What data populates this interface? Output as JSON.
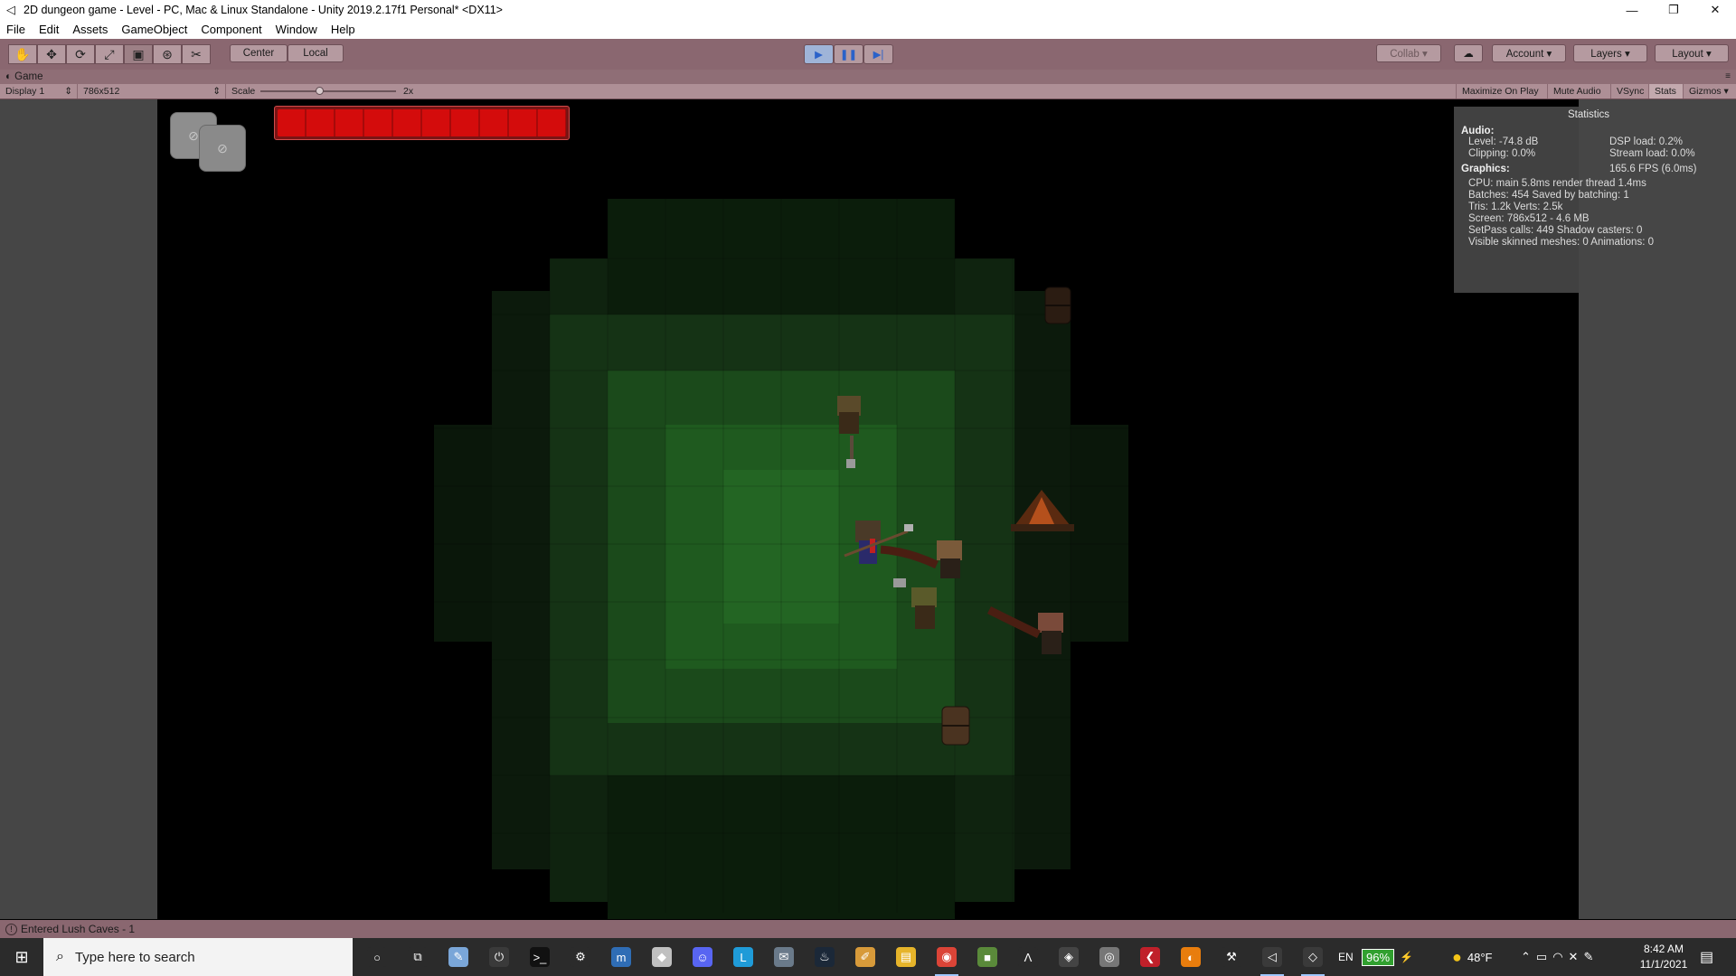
{
  "window": {
    "title": "2D dungeon game - Level - PC, Mac & Linux Standalone - Unity 2019.2.17f1 Personal* <DX11>",
    "app_icon": "unity-logo-icon",
    "controls": {
      "minimize": "—",
      "restore": "❐",
      "close": "✕"
    }
  },
  "menu": [
    "File",
    "Edit",
    "Assets",
    "GameObject",
    "Component",
    "Window",
    "Help"
  ],
  "toolbar": {
    "tools": [
      {
        "name": "hand-tool",
        "glyph": "✋"
      },
      {
        "name": "move-tool",
        "glyph": "✥"
      },
      {
        "name": "rotate-tool",
        "glyph": "⟳"
      },
      {
        "name": "scale-tool",
        "glyph": "⤢"
      },
      {
        "name": "rect-tool",
        "glyph": "▣"
      },
      {
        "name": "transform-tool",
        "glyph": "⊛"
      },
      {
        "name": "custom-tool",
        "glyph": "✂"
      }
    ],
    "pivot": "Center",
    "space": "Local",
    "play": "▶",
    "pause": "❚❚",
    "step": "▶|",
    "collab": "Collab ▾",
    "cloud": "☁",
    "account": "Account ▾",
    "layers": "Layers ▾",
    "layout": "Layout ▾"
  },
  "game_view": {
    "tab": "Game",
    "display": "Display 1",
    "resolution": "786x512",
    "scale_label": "Scale",
    "scale_value": "2x",
    "buttons": [
      "Maximize On Play",
      "Mute Audio",
      "VSync",
      "Stats",
      "Gizmos ▾"
    ]
  },
  "hud": {
    "slot_icon": "⊘",
    "health_fraction": 1.0
  },
  "stats": {
    "title": "Statistics",
    "audio_header": "Audio:",
    "audio": [
      [
        "Level: -74.8 dB",
        "DSP load: 0.2%"
      ],
      [
        "Clipping: 0.0%",
        "Stream load: 0.0%"
      ]
    ],
    "graphics_header": "Graphics:",
    "fps": "165.6 FPS (6.0ms)",
    "graphics": [
      "CPU: main 5.8ms  render thread 1.4ms",
      "Batches: 454       Saved by batching: 1",
      "Tris: 1.2k           Verts: 2.5k",
      "Screen: 786x512 - 4.6 MB",
      "SetPass calls: 449   Shadow casters: 0",
      "Visible skinned meshes: 0  Animations: 0"
    ]
  },
  "status": {
    "message": "Entered Lush Caves - 1"
  },
  "taskbar": {
    "search_placeholder": "Type here to search",
    "language": "EN",
    "battery": "96%",
    "temperature": "48°F",
    "time": "8:42 AM",
    "date": "11/1/2021",
    "apps": [
      {
        "name": "cortana-icon",
        "glyph": "○",
        "color": "#2b2b2b"
      },
      {
        "name": "task-view-icon",
        "glyph": "⧉",
        "color": "#2b2b2b"
      },
      {
        "name": "paint-app-icon",
        "glyph": "✎",
        "color": "#7aa6d8"
      },
      {
        "name": "power-app-icon",
        "glyph": "⏻",
        "color": "#3a3a3a"
      },
      {
        "name": "terminal-icon",
        "glyph": ">_",
        "color": "#111111"
      },
      {
        "name": "settings-icon",
        "glyph": "⚙",
        "color": "#2b2b2b"
      },
      {
        "name": "musescore-icon",
        "glyph": "m",
        "color": "#2f6db5"
      },
      {
        "name": "game-app-icon",
        "glyph": "◆",
        "color": "#c0c0c0"
      },
      {
        "name": "discord-icon",
        "glyph": "☺",
        "color": "#5865f2"
      },
      {
        "name": "l-app-icon",
        "glyph": "L",
        "color": "#1f9bd8"
      },
      {
        "name": "mail-app-icon",
        "glyph": "✉",
        "color": "#6a7a8a"
      },
      {
        "name": "steam-icon",
        "glyph": "♨",
        "color": "#1b2838"
      },
      {
        "name": "note-app-icon",
        "glyph": "✐",
        "color": "#d79a3a"
      },
      {
        "name": "file-explorer-icon",
        "glyph": "▤",
        "color": "#e6b42a"
      },
      {
        "name": "chrome-icon",
        "glyph": "◉",
        "color": "#db4437"
      },
      {
        "name": "minecraft-icon",
        "glyph": "■",
        "color": "#5a8a3a"
      },
      {
        "name": "vector-app-icon",
        "glyph": "Λ",
        "color": "#2b2b2b"
      },
      {
        "name": "unity-hub-icon",
        "glyph": "◈",
        "color": "#444444"
      },
      {
        "name": "gimp-icon",
        "glyph": "◎",
        "color": "#777777"
      },
      {
        "name": "red-app-icon",
        "glyph": "❮",
        "color": "#c0202a"
      },
      {
        "name": "blender-icon",
        "glyph": "◐",
        "color": "#e87d0d"
      },
      {
        "name": "tool-app-icon",
        "glyph": "⚒",
        "color": "#2b2b2b"
      },
      {
        "name": "unity-icon",
        "glyph": "◁",
        "color": "#3a3a3a"
      },
      {
        "name": "git-app-icon",
        "glyph": "◇",
        "color": "#3a3a3a"
      }
    ]
  }
}
